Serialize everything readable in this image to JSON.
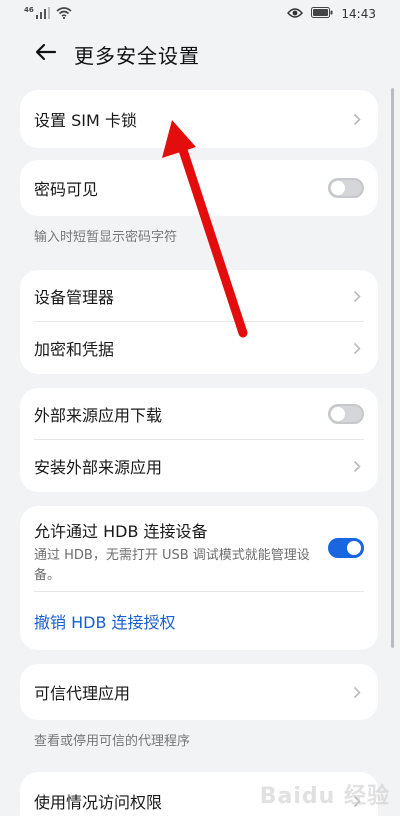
{
  "status_bar": {
    "signal": "46",
    "time": "14:43"
  },
  "header": {
    "title": "更多安全设置"
  },
  "card_sim": {
    "label": "设置 SIM 卡锁"
  },
  "card_password": {
    "label": "密码可见",
    "toggle_on": false,
    "hint": "输入时短暂显示密码字符"
  },
  "card_device": {
    "manager_label": "设备管理器",
    "encrypt_label": "加密和凭据"
  },
  "card_external": {
    "download_label": "外部来源应用下载",
    "download_on": false,
    "install_label": "安装外部来源应用"
  },
  "card_hdb": {
    "title": "允许通过 HDB 连接设备",
    "desc": "通过 HDB，无需打开 USB 调试模式就能管理设备。",
    "toggle_on": true,
    "revoke_label": "撤销 HDB 连接授权"
  },
  "card_trust": {
    "label": "可信代理应用",
    "hint": "查看或停用可信的代理程序"
  },
  "card_usage": {
    "label": "使用情况访问权限"
  },
  "colors": {
    "accent": "#1a66e0",
    "arrow": "#e30d0d",
    "background": "#f1f3f5"
  },
  "icons": [
    "signal-icon",
    "wifi-icon",
    "eye-icon",
    "battery-icon",
    "back-arrow-icon",
    "chevron-right-icon",
    "red-arrow-annotation"
  ],
  "watermark": "Baidu 经验"
}
